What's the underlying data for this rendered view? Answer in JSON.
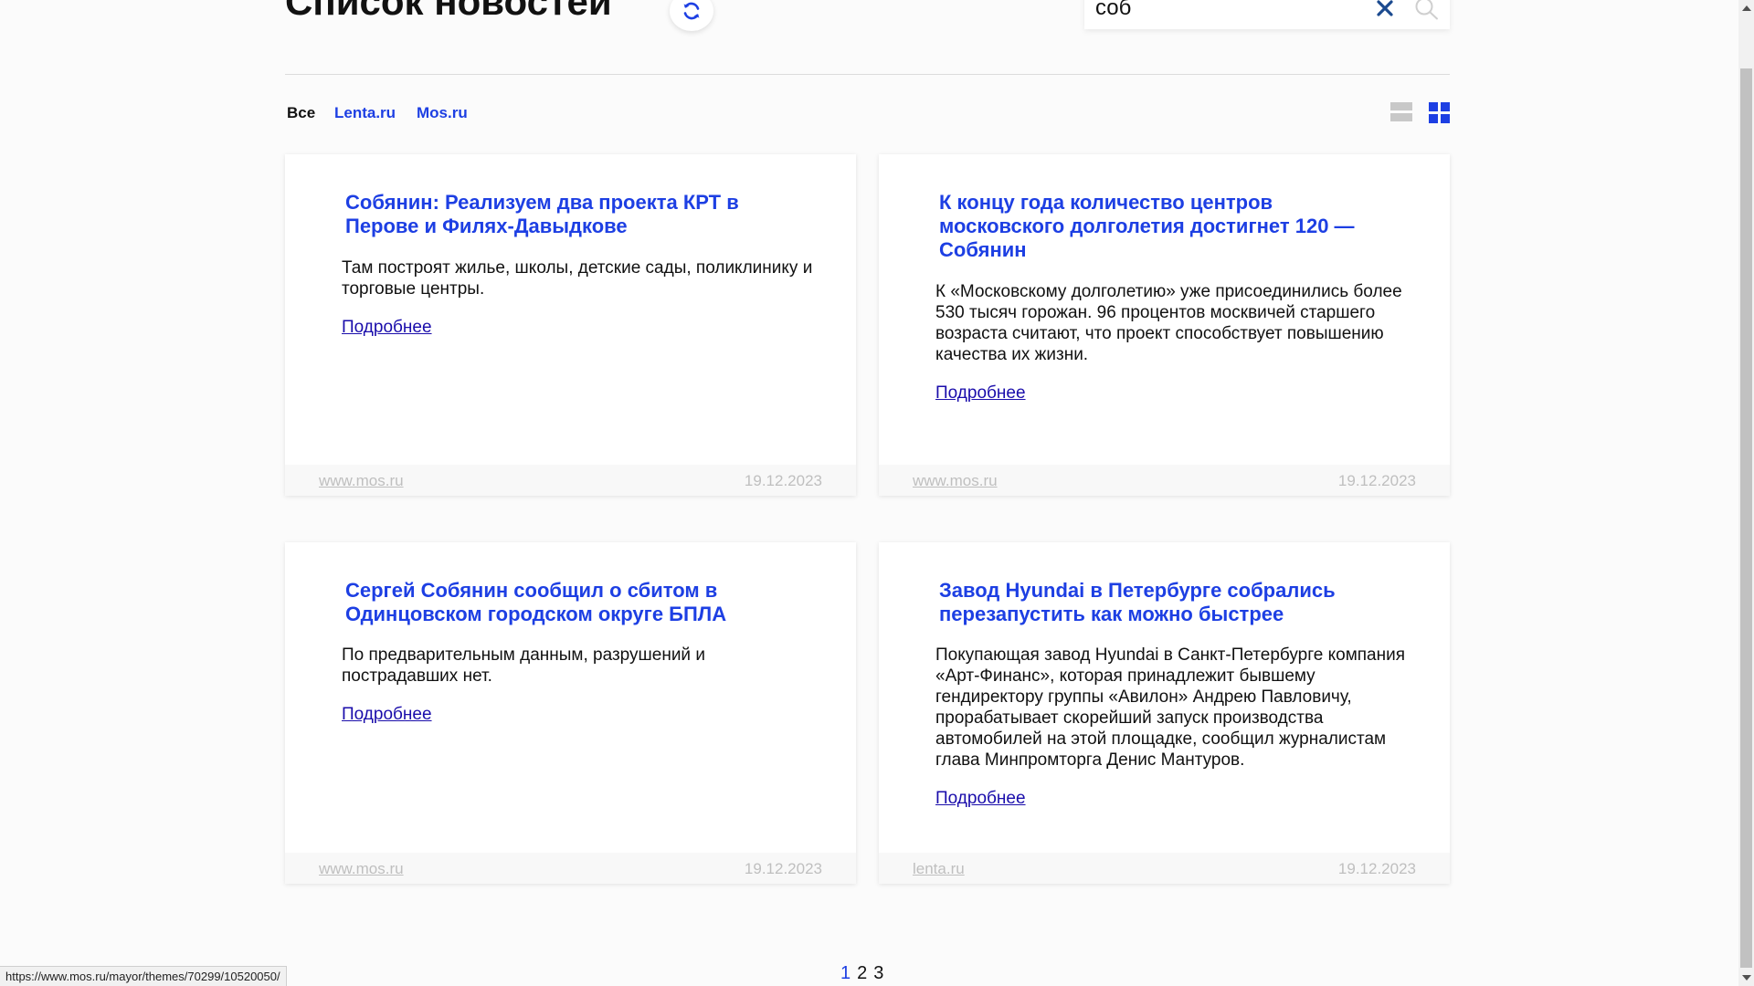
{
  "header": {
    "title": "Список новостей",
    "search_value": "соб"
  },
  "filters": [
    {
      "label": "Все",
      "active": true
    },
    {
      "label": "Lenta.ru",
      "active": false
    },
    {
      "label": "Mos.ru",
      "active": false
    }
  ],
  "view": {
    "selected": "grid"
  },
  "cards": [
    {
      "title": "Собянин: Реализуем два проекта КРТ в Перове и Филях-Давыдкове",
      "text": "Там построят жилье, школы, детские сады, поликлинику и торговые центры.",
      "link": "Подробнее",
      "source": "www.mos.ru",
      "date": "19.12.2023"
    },
    {
      "title": "К концу года количество центров московского долголетия достигнет 120 — Собянин",
      "text": "К «Московскому долголетию» уже присоединились более 530 тысяч горожан. 96 процентов москвичей старшего возраста считают, что проект способствует повышению качества их жизни.",
      "link": "Подробнее",
      "source": "www.mos.ru",
      "date": "19.12.2023"
    },
    {
      "title": "Сергей Собянин сообщил о сбитом в Одинцовском городском округе БПЛА",
      "text": "По предварительным данным, разрушений и пострадавших нет.",
      "link": "Подробнее",
      "source": "www.mos.ru",
      "date": "19.12.2023"
    },
    {
      "title": "Завод Hyundai в Петербурге собрались перезапустить как можно быстрее",
      "text": "Покупающая завод Hyundai в Санкт-Петербурге компания «Арт-Финанс», которая принадлежит бывшему гендиректору группы «Авилон» Андрею Павловичу, прорабатывает скорейший запуск производства автомобилей на этой площадке, сообщил журналистам глава Минпромторга Денис Мантуров.",
      "link": "Подробнее",
      "source": "lenta.ru",
      "date": "19.12.2023"
    }
  ],
  "pagination": {
    "pages": [
      "1",
      "2",
      "3"
    ],
    "current": "1"
  },
  "status_url": "https://www.mos.ru/mayor/themes/70299/10520050/",
  "colors": {
    "accent": "#1d3fe3",
    "link": "#1a0dab",
    "footer_text": "#bfbfbf"
  }
}
